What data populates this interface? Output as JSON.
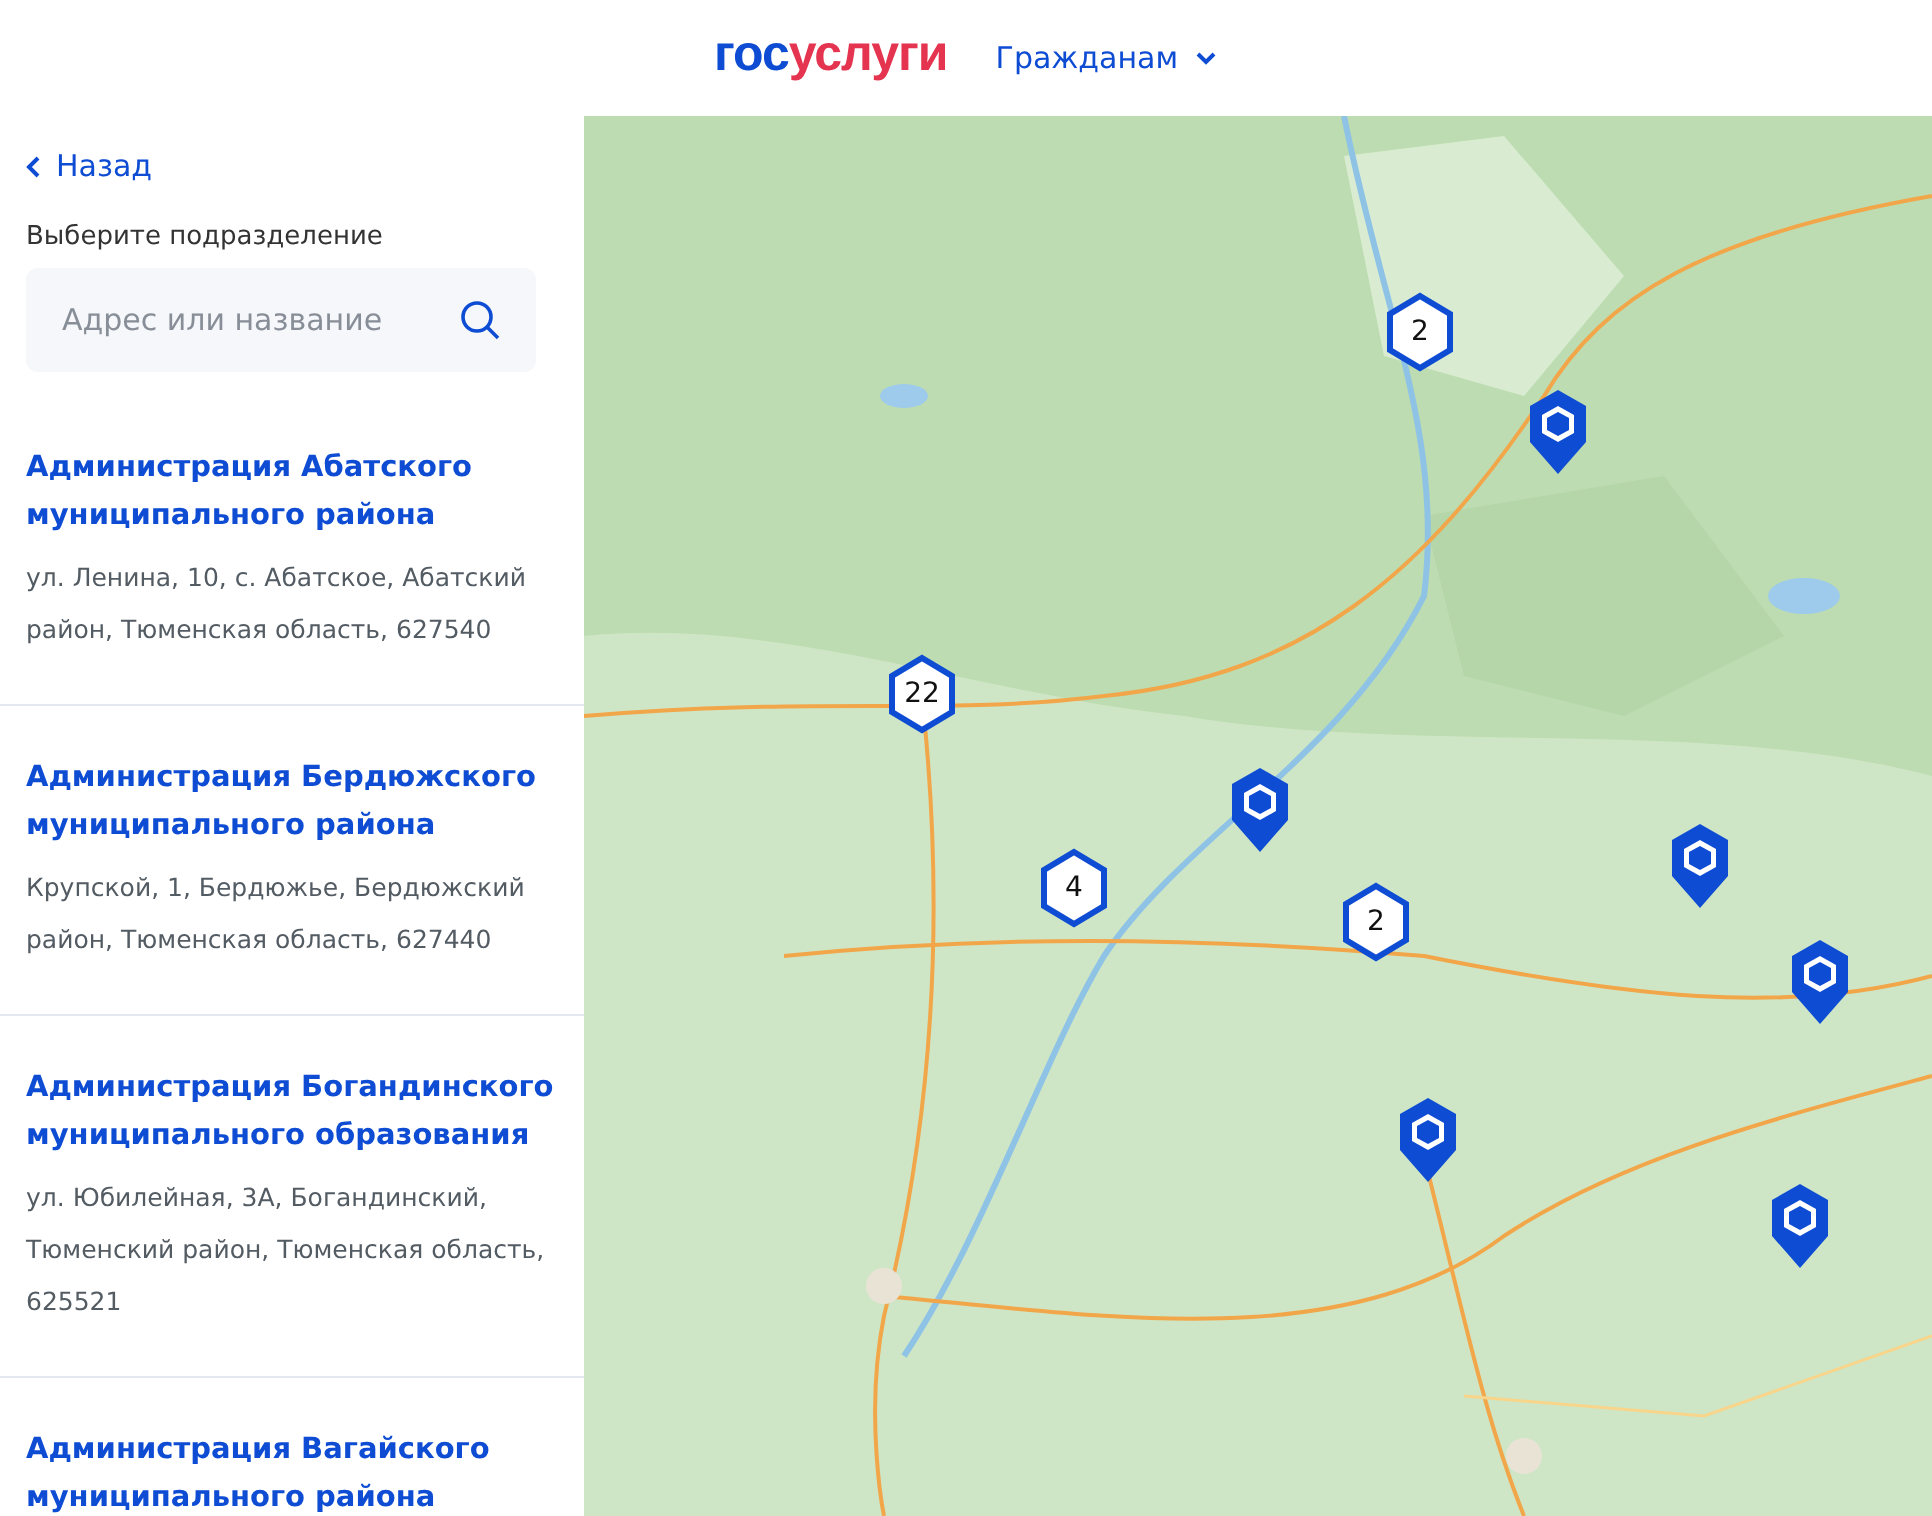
{
  "header": {
    "logo": {
      "primary": "гос",
      "accent": "услуги"
    },
    "menu": {
      "label": "Гражданам",
      "expanded": false
    }
  },
  "sidebar": {
    "back": "Назад",
    "prompt": "Выберите подразделение",
    "search": {
      "placeholder": "Адрес или название"
    },
    "items": [
      {
        "title": "Администрация Абатского муниципального района",
        "address": "ул. Ленина, 10, с. Абатское, Абатский район, Тюменская область, 627540"
      },
      {
        "title": "Администрация Бердюжского муниципального района",
        "address": "Крупской, 1, Бердюжье, Бердюжский район, Тюменская область, 627440"
      },
      {
        "title": "Администрация Богандинского муниципального образования",
        "address": "ул. Юбилейная, 3А, Богандинский, Тюменский район, Тюменская область, 625521"
      },
      {
        "title": "Администрация Вагайского муниципального района"
      }
    ]
  },
  "map": {
    "markers": [
      {
        "kind": "cluster",
        "count": "2"
      },
      {
        "kind": "pin"
      },
      {
        "kind": "cluster",
        "count": "22"
      },
      {
        "kind": "pin"
      },
      {
        "kind": "cluster",
        "count": "4"
      },
      {
        "kind": "pin"
      },
      {
        "kind": "cluster",
        "count": "2"
      },
      {
        "kind": "pin"
      },
      {
        "kind": "pin"
      },
      {
        "kind": "pin"
      }
    ]
  }
}
